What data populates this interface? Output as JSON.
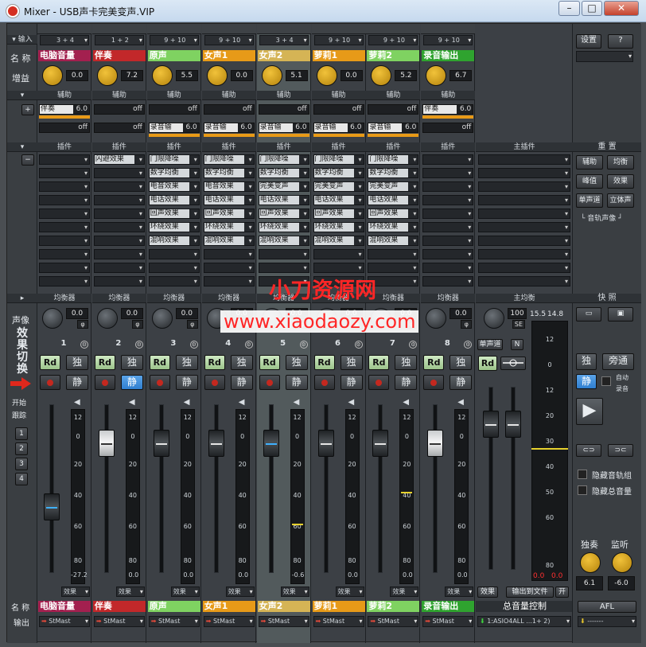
{
  "window": {
    "title": "Mixer - USB声卡完美变声.VIP"
  },
  "sidebar": {
    "input_label": "输入",
    "name_label": "名 称",
    "gain_label": "增益",
    "pan_label": "声像",
    "fx_switch_label": "效果切换",
    "track_label": "开始跟踪",
    "track_buttons": [
      "1",
      "2",
      "3",
      "4"
    ],
    "name_label_bottom": "名 称",
    "output_label": "输出",
    "add_symbol": "+",
    "remove_symbol": "−"
  },
  "section_headers": {
    "aux": "辅助",
    "plugin": "插件",
    "main_plugin": "主插件",
    "eq": "均衡器",
    "main_eq": "主均衡"
  },
  "channels": [
    {
      "num": "1",
      "input": "3 + 4",
      "name": "电脑音量",
      "color": "#a3204f",
      "gain": "0.0",
      "aux1": {
        "fx": "伴奏",
        "val": "6.0"
      },
      "aux2": {
        "fx": "",
        "val": "off"
      },
      "plugins": [
        "",
        "",
        "",
        "",
        "",
        "",
        "",
        "",
        ""
      ],
      "pan": "0.0",
      "fader_level": "-27.2",
      "output": "StMast",
      "fx_label": "效果"
    },
    {
      "num": "2",
      "input": "1 + 2",
      "name": "伴奏",
      "color": "#c2282a",
      "gain": "7.2",
      "aux1": {
        "fx": "",
        "val": "off"
      },
      "aux2": {
        "fx": "",
        "val": "off"
      },
      "plugins": [
        "闪避效果",
        "",
        "",
        "",
        "",
        "",
        "",
        "",
        ""
      ],
      "pan": "0.0",
      "fader_level": "0.0",
      "output": "StMast",
      "fx_label": "效果"
    },
    {
      "num": "3",
      "input": "9 + 10",
      "name": "原声",
      "color": "#7fd261",
      "gain": "5.5",
      "aux1": {
        "fx": "",
        "val": "off"
      },
      "aux2": {
        "fx": "录音输",
        "val": "6.0"
      },
      "plugins": [
        "门限降噪",
        "数字均衡",
        "电音效果",
        "电话效果",
        "回声效果",
        "环绕效果",
        "混响效果",
        "",
        ""
      ],
      "pan": "0.0",
      "fader_level": "0.0",
      "output": "StMast",
      "fx_label": "效果"
    },
    {
      "num": "4",
      "input": "9 + 10",
      "name": "女声1",
      "color": "#e79a18",
      "gain": "0.0",
      "aux1": {
        "fx": "",
        "val": "off"
      },
      "aux2": {
        "fx": "录音输",
        "val": "6.0"
      },
      "plugins": [
        "门限降噪",
        "数字均衡",
        "电音效果",
        "电话效果",
        "回声效果",
        "环绕效果",
        "混响效果",
        "",
        ""
      ],
      "pan": "0.0",
      "fader_level": "0.0",
      "output": "StMast",
      "fx_label": "效果"
    },
    {
      "num": "5",
      "input": "3 + 4",
      "name": "女声2",
      "color": "#d5b455",
      "gain": "5.1",
      "aux1": {
        "fx": "",
        "val": "off"
      },
      "aux2": {
        "fx": "录音输",
        "val": "6.0"
      },
      "plugins": [
        "门限降噪",
        "数字均衡",
        "完美变声",
        "电话效果",
        "回声效果",
        "环绕效果",
        "混响效果",
        "",
        ""
      ],
      "pan": "0.0",
      "fader_level": "-0.6",
      "output": "StMast",
      "fx_label": "效果"
    },
    {
      "num": "6",
      "input": "9 + 10",
      "name": "萝莉1",
      "color": "#e79a18",
      "gain": "0.0",
      "aux1": {
        "fx": "",
        "val": "off"
      },
      "aux2": {
        "fx": "录音输",
        "val": "6.0"
      },
      "plugins": [
        "门限降噪",
        "数字均衡",
        "完美变声",
        "电话效果",
        "回声效果",
        "环绕效果",
        "混响效果",
        "",
        ""
      ],
      "pan": "0.0",
      "fader_level": "0.0",
      "output": "StMast",
      "fx_label": "效果"
    },
    {
      "num": "7",
      "input": "9 + 10",
      "name": "萝莉2",
      "color": "#7fd261",
      "gain": "5.2",
      "aux1": {
        "fx": "",
        "val": "off"
      },
      "aux2": {
        "fx": "录音输",
        "val": "6.0"
      },
      "plugins": [
        "门限降噪",
        "数字均衡",
        "完美变声",
        "电话效果",
        "回声效果",
        "环绕效果",
        "混响效果",
        "",
        ""
      ],
      "pan": "0.0",
      "fader_level": "0.0",
      "output": "StMast",
      "fx_label": "效果"
    },
    {
      "num": "8",
      "input": "9 + 10",
      "name": "录音输出",
      "color": "#2fa32f",
      "gain": "6.7",
      "aux1": {
        "fx": "伴奏",
        "val": "6.0"
      },
      "aux2": {
        "fx": "",
        "val": "off"
      },
      "plugins": [
        "",
        "",
        "",
        "",
        "",
        "",
        "",
        "",
        ""
      ],
      "pan": "0.0",
      "fader_level": "0.0",
      "output": "StMast",
      "fx_label": "效果"
    }
  ],
  "master": {
    "pan_value": "100",
    "se_label": "SE",
    "mono_button": "单声道",
    "n_button": "N",
    "peak_left": "15.5",
    "peak_right": "14.8",
    "clip_left": "0.0",
    "clip_right": "0.0",
    "fx_button": "效果",
    "export_button": "输出到文件",
    "on_button": "开",
    "name": "总音量控制",
    "output": "1:ASIO4ALL ...1+ 2)"
  },
  "channel_buttons": {
    "read": "Rd",
    "solo": "独",
    "mute": "静"
  },
  "meter_scale": [
    "12",
    "0",
    "20",
    "40",
    "60",
    "80"
  ],
  "master_meter_scale": [
    "12",
    "0",
    "12",
    "20",
    "30",
    "40",
    "50",
    "60",
    "80"
  ],
  "right_panel": {
    "settings_button": "设置",
    "help_button": "?",
    "reset_label": "重 置",
    "reset_buttons": [
      "辅助",
      "均衡",
      "峰值",
      "效果",
      "单声道",
      "立体声"
    ],
    "pan_reset_label": "音轨声像",
    "snapshot_label": "快 照",
    "solo_button": "独",
    "bypass_button": "旁通",
    "mute_button": "静",
    "auto_label": "自动",
    "record_label": "录音",
    "hide_tracks_group": "隐藏音轨组",
    "hide_master": "隐藏总音量",
    "solo_label": "独奏",
    "monitor_label": "监听",
    "solo_value": "6.1",
    "monitor_value": "-6.0",
    "afl_button": "AFL"
  },
  "watermark": {
    "line1": "小刀资源网",
    "line2": "www.xiaodaozy.com"
  },
  "colors": {
    "accent_orange": "#e89a17",
    "button_blue": "#2f7fd0",
    "panel": "#3c4045"
  }
}
